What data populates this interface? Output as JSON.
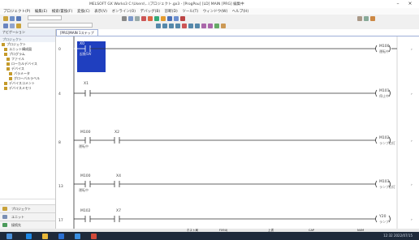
{
  "window": {
    "title": "MELSOFT GX Works3 C:\\Users\\...\\プロジェクト.gx3 - [ProgPou] [LD] MAIN [PRG] 編集中",
    "minimize": "–",
    "close": "×"
  },
  "menu": [
    "プロジェクト(P)",
    "編集(E)",
    "検索/置換(F)",
    "変換(C)",
    "表示(V)",
    "オンライン(O)",
    "デバッグ(B)",
    "診断(D)",
    "ツール(T)",
    "ウィンドウ(W)",
    "ヘルプ(H)"
  ],
  "toolbar": {
    "combo1": "",
    "combo2": ""
  },
  "navigation": {
    "pane_tabs": "ナビゲーション",
    "header": "プロジェクト",
    "tree": [
      "プロジェクト",
      "ユニット構成図",
      "プログラム",
      "ファイル",
      "ローカルデバイス",
      "デバイス",
      "パラメータ",
      "グローバルラベル",
      "デバイスコメント",
      "デバイスメモリ"
    ],
    "bottom": [
      "プロジェクト",
      "ユニット",
      "接続先"
    ]
  },
  "editor": {
    "tab_label": "[PRG]MAIN 1ステップ"
  },
  "rungs": [
    {
      "step": "0",
      "contact_label": "X0",
      "contact_comment": "起動SW",
      "coil": "M100",
      "coil_comment": "運転中"
    },
    {
      "step": "4",
      "contact_label": "X1",
      "contact_comment": "",
      "coil": "M101",
      "coil_comment": "停止中"
    },
    {
      "step": "8",
      "contact_label": "M100",
      "contact_comment": "運転中",
      "contact2_label": "X2",
      "contact2_comment": "",
      "coil": "M102",
      "coil_comment": "ランプ点灯"
    },
    {
      "step": "13",
      "contact_label": "M100",
      "contact_comment": "運転中",
      "contact2_label": "X4",
      "contact2_comment": "",
      "coil": "M103",
      "coil_comment": "ランプ点灯"
    },
    {
      "step": "17",
      "contact_label": "M102",
      "contact_comment": "",
      "contact2_label": "X7",
      "contact2_comment": "",
      "coil": "Y20",
      "coil_comment": "ランプ"
    }
  ],
  "status_bar": [
    "ホスト局",
    "FX5UJ",
    "上書",
    "CAP",
    "NUM"
  ],
  "tray": "12:32 2022/07/15",
  "colors": {
    "selected": "#1f3fbf",
    "ladder": "#222222"
  }
}
